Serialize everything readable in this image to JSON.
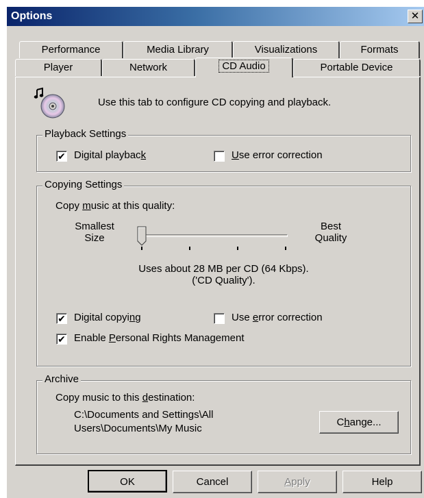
{
  "window": {
    "title": "Options",
    "close_glyph": "✕"
  },
  "tabs_row1": [
    "Performance",
    "Media Library",
    "Visualizations",
    "Formats"
  ],
  "tabs_row2": [
    "Player",
    "Network",
    "CD Audio",
    "Portable Device"
  ],
  "active_tab": "CD Audio",
  "intro": {
    "icon": "cd-music-icon",
    "text": "Use this tab to configure CD copying and playback."
  },
  "playback": {
    "legend": "Playback Settings",
    "digital_playback": {
      "label_pre": "Digital playbac",
      "label_u": "k",
      "label_post": "",
      "checked": true
    },
    "error_correction": {
      "label_pre": "",
      "label_u": "U",
      "label_post": "se error correction",
      "checked": false
    }
  },
  "copying": {
    "legend": "Copying Settings",
    "quality_label_pre": "Copy ",
    "quality_label_u": "m",
    "quality_label_post": "usic at this quality:",
    "slider_left_line1": "Smallest",
    "slider_left_line2": "Size",
    "slider_right_line1": "Best",
    "slider_right_line2": "Quality",
    "slider_value": 0,
    "usage_line1": "Uses about 28 MB per CD (64 Kbps).",
    "usage_line2": "('CD Quality').",
    "digital_copying": {
      "label_pre": "Digital copyi",
      "label_u": "n",
      "label_post": "g",
      "checked": true
    },
    "error_correction": {
      "label_pre": "Use ",
      "label_u": "e",
      "label_post": "rror correction",
      "checked": false
    },
    "prm": {
      "label_pre": "Enable ",
      "label_u": "P",
      "label_post": "ersonal Rights Management",
      "checked": true
    }
  },
  "archive": {
    "legend": "Archive",
    "dest_label_pre": "Copy music to this ",
    "dest_label_u": "d",
    "dest_label_post": "estination:",
    "path_line1": "C:\\Documents and Settings\\All",
    "path_line2": "Users\\Documents\\My Music",
    "change_pre": "C",
    "change_u": "h",
    "change_post": "ange..."
  },
  "buttons": {
    "ok": "OK",
    "cancel": "Cancel",
    "apply_u": "A",
    "apply_post": "pply",
    "help": "Help"
  },
  "check_glyph": "✔"
}
